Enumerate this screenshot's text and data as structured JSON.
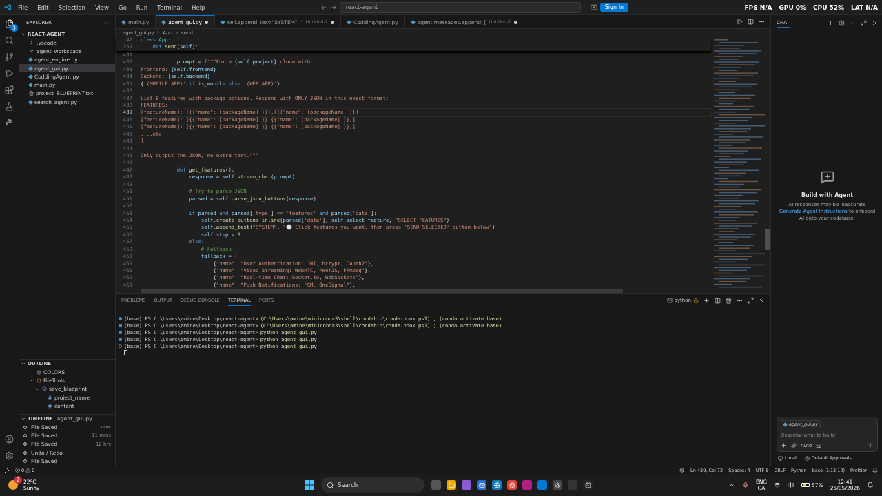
{
  "title_bar": {
    "menu": [
      "File",
      "Edit",
      "Selection",
      "View",
      "Go",
      "Run",
      "Terminal",
      "Help"
    ],
    "search": "react-agent",
    "sign_in": "Sign In",
    "overlay": [
      {
        "label": "FPS",
        "value": "N/A"
      },
      {
        "label": "GPU",
        "value": "0%"
      },
      {
        "label": "CPU",
        "value": "52%"
      },
      {
        "label": "LAT",
        "value": "N/A"
      }
    ]
  },
  "activity_bar": {
    "badge": "3"
  },
  "explorer": {
    "title": "EXPLORER",
    "root": "REACT-AGENT",
    "items": [
      {
        "name": ".vscode",
        "kind": "folder",
        "expanded": false,
        "selected": false
      },
      {
        "name": "agent_workspace",
        "kind": "folder",
        "expanded": true,
        "selected": false
      },
      {
        "name": "agent_engine.py",
        "kind": "python",
        "selected": false
      },
      {
        "name": "agent_gui.py",
        "kind": "python",
        "selected": true
      },
      {
        "name": "CoddingAgent.py",
        "kind": "python",
        "selected": false
      },
      {
        "name": "main.py",
        "kind": "python",
        "selected": false
      },
      {
        "name": "project_BLUEPRINT.txt",
        "kind": "text",
        "selected": false
      },
      {
        "name": "search_agent.py",
        "kind": "python",
        "selected": false
      }
    ]
  },
  "outline": {
    "title": "OUTLINE",
    "items": [
      {
        "name": "COLORS",
        "kind": "constant"
      },
      {
        "name": "FileTools",
        "kind": "class",
        "expanded": true,
        "children": [
          {
            "name": "save_blueprint",
            "kind": "method",
            "expanded": true,
            "children": [
              {
                "name": "project_name",
                "kind": "variable"
              },
              {
                "name": "content",
                "kind": "variable"
              }
            ]
          }
        ]
      }
    ]
  },
  "timeline": {
    "title": "TIMELINE",
    "file": "agent_gui.py",
    "items": [
      {
        "label": "File Saved",
        "time": "now"
      },
      {
        "label": "File Saved",
        "time": "11 mins"
      },
      {
        "label": "File Saved",
        "time": "12 hrs"
      },
      {
        "label": "Undo / Redo"
      },
      {
        "label": "File Saved"
      }
    ]
  },
  "tabs": [
    {
      "label": "main.py",
      "selected": false,
      "modified": false
    },
    {
      "label": "agent_gui.py",
      "selected": true,
      "modified": true
    },
    {
      "label": "self.append_text(\"SYSTEM\", \"",
      "description": "Untitled-2",
      "selected": false,
      "modified": true
    },
    {
      "label": "CoddingAgent.py",
      "selected": false,
      "modified": false
    },
    {
      "label": "agent.messages.append({",
      "description": "Untitled-1",
      "selected": false,
      "modified": true
    }
  ],
  "breadcrumbs": [
    "agent_gui.py",
    "App",
    "send"
  ],
  "sticky_lines": [
    {
      "number": "42",
      "tokens": [
        {
          "kind": "kw",
          "text": "class "
        },
        {
          "kind": "cls",
          "text": "App"
        },
        {
          "kind": "plain",
          "text": ":"
        }
      ]
    },
    {
      "number": "359",
      "tokens": [
        {
          "kind": "kw",
          "text": "    def "
        },
        {
          "kind": "fn",
          "text": "send"
        },
        {
          "kind": "plain",
          "text": "("
        },
        {
          "kind": "var",
          "text": "self"
        },
        {
          "kind": "plain",
          "text": "):"
        }
      ]
    }
  ],
  "code_lines": [
    {
      "number": "431",
      "current": false
    },
    {
      "number": "432",
      "current": false,
      "tokens": [
        {
          "kind": "var",
          "text": "            prompt"
        },
        {
          "kind": "plain",
          "text": " = "
        },
        {
          "kind": "kw",
          "text": "f"
        },
        {
          "kind": "str",
          "text": "\"\"\"For a "
        },
        {
          "kind": "var",
          "text": "{self.project}"
        },
        {
          "kind": "str",
          "text": " clone with:"
        }
      ]
    },
    {
      "number": "433",
      "current": false,
      "tokens": [
        {
          "kind": "str",
          "text": "Frontend: "
        },
        {
          "kind": "var",
          "text": "{self.frontend}"
        }
      ]
    },
    {
      "number": "434",
      "current": false,
      "tokens": [
        {
          "kind": "str",
          "text": "Backend: "
        },
        {
          "kind": "var",
          "text": "{self.backend}"
        }
      ]
    },
    {
      "number": "435",
      "current": false,
      "tokens": [
        {
          "kind": "plain",
          "text": "{"
        },
        {
          "kind": "str",
          "text": "'(MOBILE APP)'"
        },
        {
          "kind": "kw",
          "text": " if "
        },
        {
          "kind": "var",
          "text": "is_mobile"
        },
        {
          "kind": "kw",
          "text": " else "
        },
        {
          "kind": "str",
          "text": "'(WEB APP)'"
        },
        {
          "kind": "plain",
          "text": "}"
        }
      ]
    },
    {
      "number": "436",
      "current": false
    },
    {
      "number": "437",
      "current": false,
      "tokens": [
        {
          "kind": "str",
          "text": "List 8 features with package options. Respond with ONLY JSON in this exact format:"
        }
      ]
    },
    {
      "number": "438",
      "current": false,
      "tokens": [
        {
          "kind": "str",
          "text": "FEATURES:"
        }
      ]
    },
    {
      "number": "439",
      "current": true,
      "tokens": [
        {
          "kind": "str",
          "text": "[featureName]: [{{\"name\": [packageName] }}],[{{\"name\": [packageName] }}]"
        }
      ]
    },
    {
      "number": "440",
      "current": false,
      "tokens": [
        {
          "kind": "str",
          "text": "[featureName]: [{{\"name\": [packageName] }},{{\"name\": [packageName] }},]"
        }
      ]
    },
    {
      "number": "441",
      "current": false,
      "tokens": [
        {
          "kind": "str",
          "text": "[featureName]: [{{\"name\": [packageName] }},{{\"name\": [packageName] }},]"
        }
      ]
    },
    {
      "number": "442",
      "current": false,
      "tokens": [
        {
          "kind": "str",
          "text": "....etc"
        }
      ]
    },
    {
      "number": "443",
      "current": false,
      "tokens": [
        {
          "kind": "str",
          "text": "]"
        }
      ]
    },
    {
      "number": "444",
      "current": false
    },
    {
      "number": "445",
      "current": false,
      "tokens": [
        {
          "kind": "str",
          "text": "Only output the JSON, no extra text.\"\"\""
        }
      ]
    },
    {
      "number": "446",
      "current": false
    },
    {
      "number": "447",
      "current": false,
      "tokens": [
        {
          "kind": "kw",
          "text": "            def "
        },
        {
          "kind": "fn",
          "text": "get_features"
        },
        {
          "kind": "plain",
          "text": "():"
        }
      ]
    },
    {
      "number": "448",
      "current": false,
      "tokens": [
        {
          "kind": "var",
          "text": "                response"
        },
        {
          "kind": "plain",
          "text": " = "
        },
        {
          "kind": "var",
          "text": "self"
        },
        {
          "kind": "plain",
          "text": "."
        },
        {
          "kind": "fn",
          "text": "stream_chat"
        },
        {
          "kind": "plain",
          "text": "("
        },
        {
          "kind": "var",
          "text": "prompt"
        },
        {
          "kind": "plain",
          "text": ")"
        }
      ]
    },
    {
      "number": "449",
      "current": false
    },
    {
      "number": "450",
      "current": false,
      "tokens": [
        {
          "kind": "cm",
          "text": "                # Try to parse JSON"
        }
      ]
    },
    {
      "number": "451",
      "current": false,
      "tokens": [
        {
          "kind": "var",
          "text": "                parsed"
        },
        {
          "kind": "plain",
          "text": " = "
        },
        {
          "kind": "var",
          "text": "self"
        },
        {
          "kind": "plain",
          "text": "."
        },
        {
          "kind": "fn",
          "text": "parse_json_buttons"
        },
        {
          "kind": "plain",
          "text": "("
        },
        {
          "kind": "var",
          "text": "response"
        },
        {
          "kind": "plain",
          "text": ")"
        }
      ]
    },
    {
      "number": "452",
      "current": false
    },
    {
      "number": "453",
      "current": false,
      "tokens": [
        {
          "kind": "kw",
          "text": "                if "
        },
        {
          "kind": "var",
          "text": "parsed"
        },
        {
          "kind": "kw",
          "text": " and "
        },
        {
          "kind": "var",
          "text": "parsed"
        },
        {
          "kind": "plain",
          "text": "["
        },
        {
          "kind": "str",
          "text": "'type'"
        },
        {
          "kind": "plain",
          "text": "] == "
        },
        {
          "kind": "str",
          "text": "'features'"
        },
        {
          "kind": "kw",
          "text": " and "
        },
        {
          "kind": "var",
          "text": "parsed"
        },
        {
          "kind": "plain",
          "text": "["
        },
        {
          "kind": "str",
          "text": "'data'"
        },
        {
          "kind": "plain",
          "text": "]:"
        }
      ]
    },
    {
      "number": "454",
      "current": false,
      "tokens": [
        {
          "kind": "var",
          "text": "                    self"
        },
        {
          "kind": "plain",
          "text": "."
        },
        {
          "kind": "fn",
          "text": "create_buttons_inline"
        },
        {
          "kind": "plain",
          "text": "("
        },
        {
          "kind": "var",
          "text": "parsed"
        },
        {
          "kind": "plain",
          "text": "["
        },
        {
          "kind": "str",
          "text": "'data'"
        },
        {
          "kind": "plain",
          "text": "], "
        },
        {
          "kind": "var",
          "text": "self"
        },
        {
          "kind": "plain",
          "text": "."
        },
        {
          "kind": "var",
          "text": "select_feature"
        },
        {
          "kind": "plain",
          "text": ", "
        },
        {
          "kind": "str",
          "text": "\"SELECT FEATURES\""
        },
        {
          "kind": "plain",
          "text": ")"
        }
      ]
    },
    {
      "number": "455",
      "current": false,
      "tokens": [
        {
          "kind": "var",
          "text": "                    self"
        },
        {
          "kind": "plain",
          "text": "."
        },
        {
          "kind": "fn",
          "text": "append_text"
        },
        {
          "kind": "plain",
          "text": "("
        },
        {
          "kind": "str",
          "text": "\"SYSTEM\""
        },
        {
          "kind": "plain",
          "text": ", "
        },
        {
          "kind": "str",
          "text": "\"⚪ Click features you want, then press 'SEND SELECTED' button below\""
        },
        {
          "kind": "plain",
          "text": ")"
        }
      ]
    },
    {
      "number": "456",
      "current": false,
      "tokens": [
        {
          "kind": "var",
          "text": "                    self"
        },
        {
          "kind": "plain",
          "text": "."
        },
        {
          "kind": "var",
          "text": "step"
        },
        {
          "kind": "plain",
          "text": " = "
        },
        {
          "kind": "num",
          "text": "3"
        }
      ]
    },
    {
      "number": "457",
      "current": false,
      "tokens": [
        {
          "kind": "kw",
          "text": "                else"
        },
        {
          "kind": "plain",
          "text": ":"
        }
      ]
    },
    {
      "number": "458",
      "current": false,
      "tokens": [
        {
          "kind": "cm",
          "text": "                    # Fallback"
        }
      ]
    },
    {
      "number": "459",
      "current": false,
      "tokens": [
        {
          "kind": "var",
          "text": "                    fallback"
        },
        {
          "kind": "plain",
          "text": " = ["
        }
      ]
    },
    {
      "number": "460",
      "current": false,
      "tokens": [
        {
          "kind": "plain",
          "text": "                        {"
        },
        {
          "kind": "str",
          "text": "\"name\""
        },
        {
          "kind": "plain",
          "text": ": "
        },
        {
          "kind": "str",
          "text": "\"User Authentication: JWT, bcrypt, OAuth2\""
        },
        {
          "kind": "plain",
          "text": "},"
        }
      ]
    },
    {
      "number": "461",
      "current": false,
      "tokens": [
        {
          "kind": "plain",
          "text": "                        {"
        },
        {
          "kind": "str",
          "text": "\"name\""
        },
        {
          "kind": "plain",
          "text": ": "
        },
        {
          "kind": "str",
          "text": "\"Video Streaming: WebRTC, PeerJS, FFmpeg\""
        },
        {
          "kind": "plain",
          "text": "},"
        }
      ]
    },
    {
      "number": "462",
      "current": false,
      "tokens": [
        {
          "kind": "plain",
          "text": "                        {"
        },
        {
          "kind": "str",
          "text": "\"name\""
        },
        {
          "kind": "plain",
          "text": ": "
        },
        {
          "kind": "str",
          "text": "\"Real-time Chat: Socket.io, WebSockets\""
        },
        {
          "kind": "plain",
          "text": "},"
        }
      ]
    },
    {
      "number": "463",
      "current": false,
      "tokens": [
        {
          "kind": "plain",
          "text": "                        {"
        },
        {
          "kind": "str",
          "text": "\"name\""
        },
        {
          "kind": "plain",
          "text": ": "
        },
        {
          "kind": "str",
          "text": "\"Push Notifications: FCM, OneSignal\""
        },
        {
          "kind": "plain",
          "text": "},"
        }
      ]
    }
  ],
  "panel": {
    "tabs": [
      {
        "label": "PROBLEMS",
        "selected": false
      },
      {
        "label": "OUTPUT",
        "selected": false
      },
      {
        "label": "DEBUG CONSOLE",
        "selected": false
      },
      {
        "label": "TERMINAL",
        "selected": true
      },
      {
        "label": "PORTS",
        "selected": false
      }
    ],
    "shell": "python",
    "lines": [
      {
        "done": true,
        "prompt": "(base) PS C:\\Users\\amine\\Desktop\\react-agent>",
        "command": "(C:\\Users\\amine\\miniconda3\\shell\\condabin\\conda-hook.ps1) ; (conda activate base)"
      },
      {
        "done": true,
        "prompt": "(base) PS C:\\Users\\amine\\Desktop\\react-agent>",
        "command": "(C:\\Users\\amine\\miniconda3\\shell\\condabin\\conda-hook.ps1) ; (conda activate base)"
      },
      {
        "done": true,
        "prompt": "(base) PS C:\\Users\\amine\\Desktop\\react-agent>",
        "command": "python agent_gui.py"
      },
      {
        "done": true,
        "prompt": "(base) PS C:\\Users\\amine\\Desktop\\react-agent>",
        "command": "python agent_gui.py"
      },
      {
        "done": false,
        "prompt": "(base) PS C:\\Users\\amine\\Desktop\\react-agent>",
        "command": "python agent_gui.py"
      }
    ]
  },
  "chat": {
    "title": "CHAT",
    "heading": "Build with Agent",
    "note": "AI responses may be inaccurate",
    "link": "Generate Agent Instructions",
    "link_rest": "to onboard AI onto your codebase.",
    "attachment": "agent_gui.py",
    "placeholder": "Describe what to build",
    "mode": "Auto",
    "location": "Local",
    "approvals": "Default Approvals"
  },
  "status_bar": {
    "errors": "0",
    "warnings": "0",
    "items": [
      "Ln 439, Col 72",
      "Spaces: 4",
      "UTF-8",
      "CRLF",
      "Python",
      "base (3.13.12)",
      "Prettier"
    ]
  },
  "taskbar": {
    "temperature": "22°C",
    "weather": "Sunny",
    "weather_badge": "2",
    "search": "Search",
    "language": "ENG",
    "layout": "GA",
    "battery": "57%",
    "time": "12:41",
    "date": "25/05/2026"
  }
}
